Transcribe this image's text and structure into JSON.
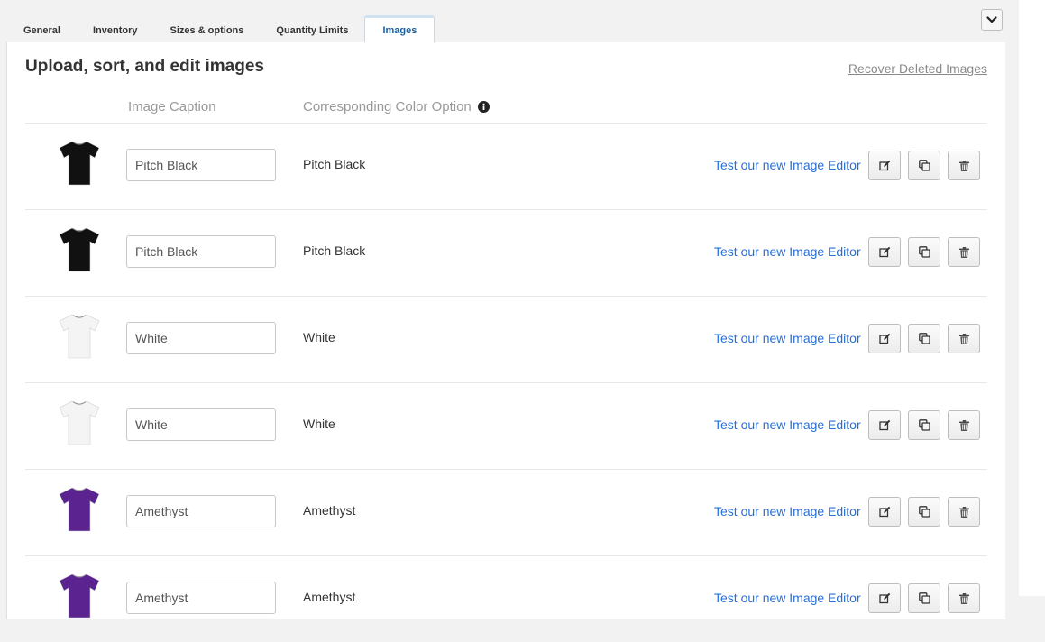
{
  "tabs": [
    {
      "label": "General",
      "active": false
    },
    {
      "label": "Inventory",
      "active": false
    },
    {
      "label": "Sizes & options",
      "active": false
    },
    {
      "label": "Quantity Limits",
      "active": false
    },
    {
      "label": "Images",
      "active": true
    }
  ],
  "panel": {
    "title": "Upload, sort, and edit images",
    "recover_link": "Recover Deleted Images",
    "columns": {
      "caption": "Image Caption",
      "color": "Corresponding Color Option"
    }
  },
  "rows": [
    {
      "caption": "Pitch Black",
      "color_option": "Pitch Black",
      "editor_link": "Test our new Image Editor",
      "shirt_color": "#111111"
    },
    {
      "caption": "Pitch Black",
      "color_option": "Pitch Black",
      "editor_link": "Test our new Image Editor",
      "shirt_color": "#111111"
    },
    {
      "caption": "White",
      "color_option": "White",
      "editor_link": "Test our new Image Editor",
      "shirt_color": "#f4f4f4"
    },
    {
      "caption": "White",
      "color_option": "White",
      "editor_link": "Test our new Image Editor",
      "shirt_color": "#f4f4f4"
    },
    {
      "caption": "Amethyst",
      "color_option": "Amethyst",
      "editor_link": "Test our new Image Editor",
      "shirt_color": "#5a2390"
    },
    {
      "caption": "Amethyst",
      "color_option": "Amethyst",
      "editor_link": "Test our new Image Editor",
      "shirt_color": "#5a2390"
    }
  ],
  "icons": {
    "collapse": "chevron-down-icon",
    "info": "info-icon",
    "edit": "edit-icon",
    "copy": "copy-icon",
    "delete": "trash-icon"
  }
}
